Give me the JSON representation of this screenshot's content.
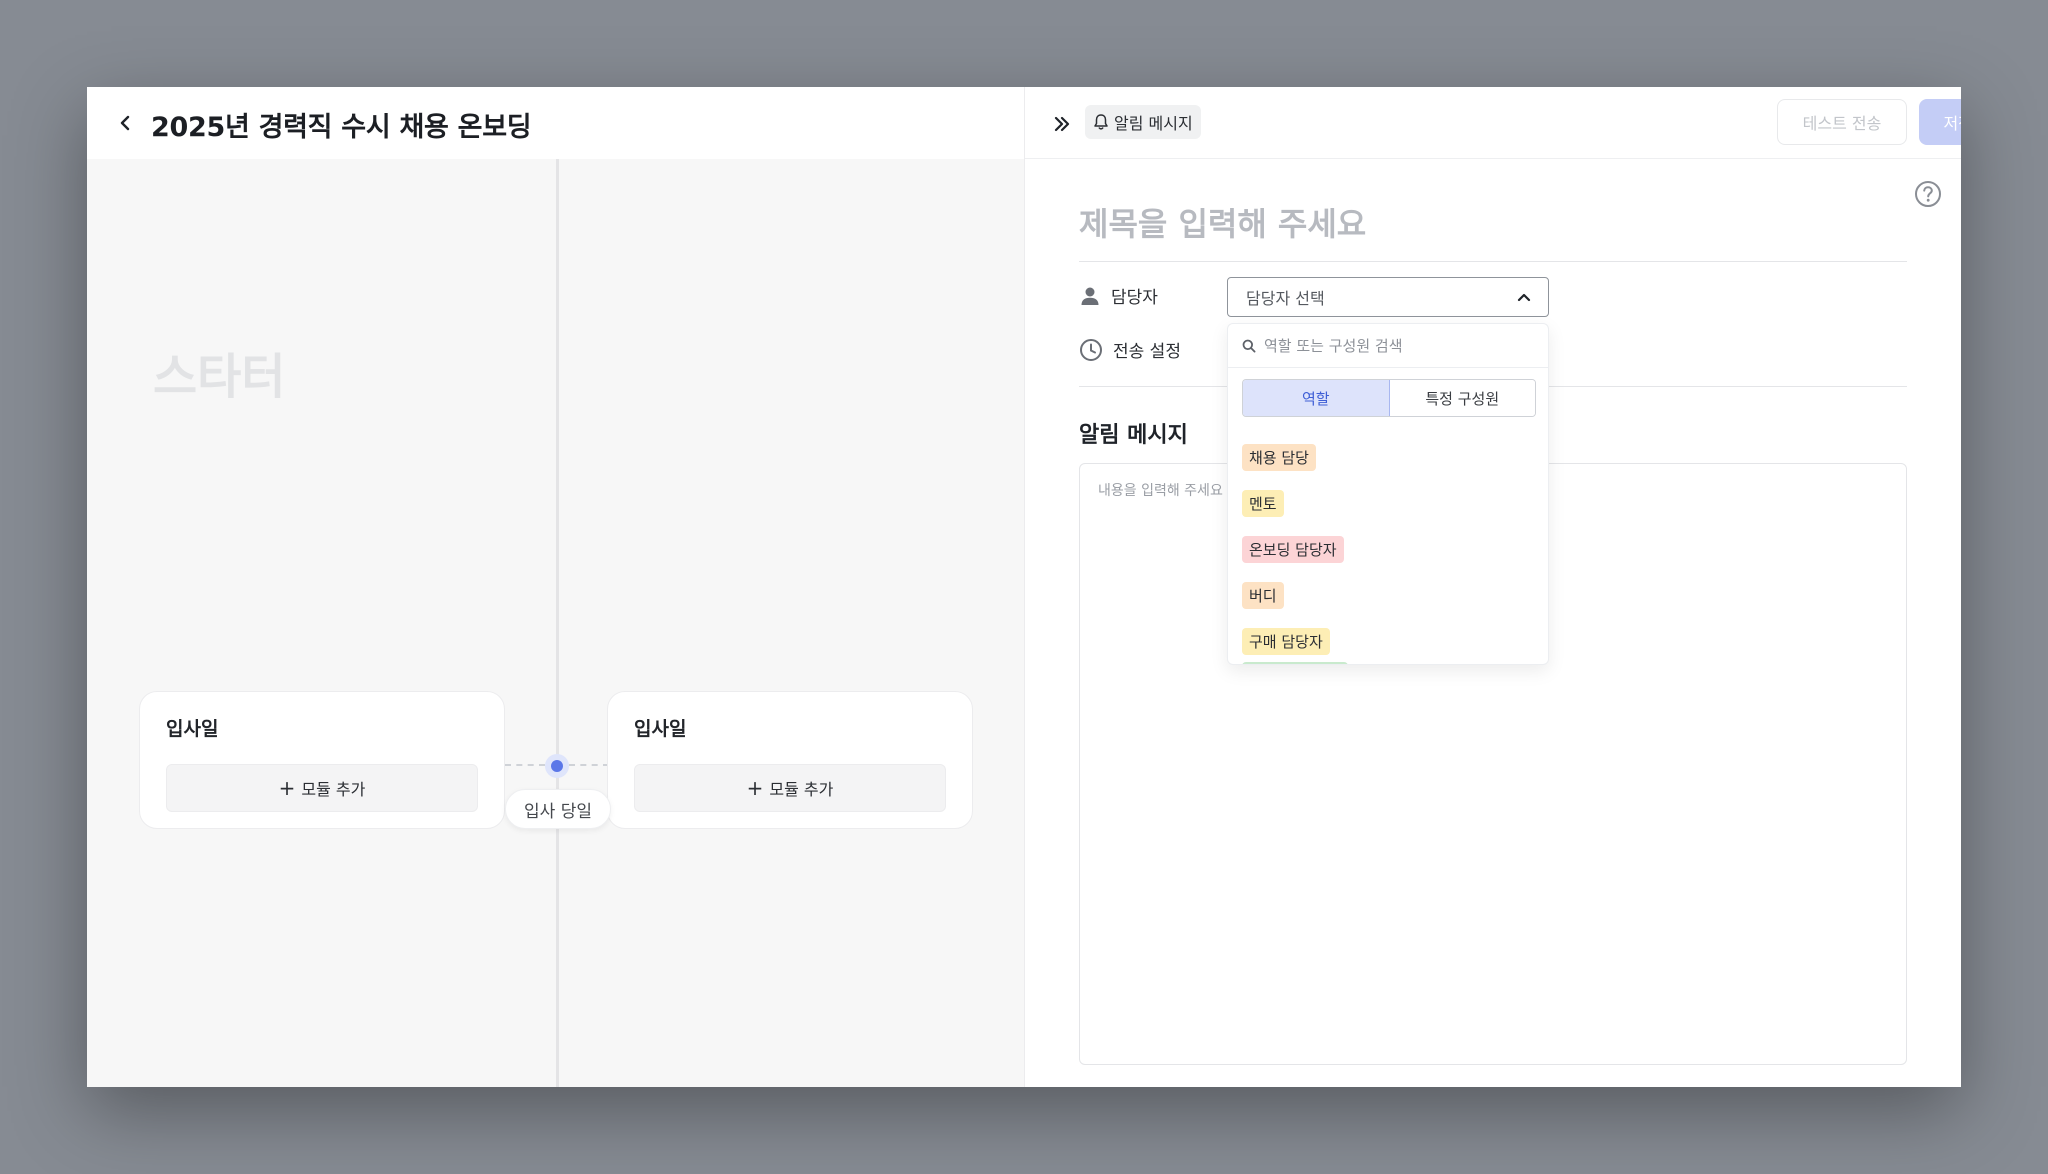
{
  "header": {
    "title": "2025년 경력직 수시 채용 온보딩"
  },
  "canvas": {
    "starter_label": "스타터",
    "cards": [
      {
        "title": "입사일",
        "add_label": "모듈 추가"
      },
      {
        "title": "입사일",
        "add_label": "모듈 추가"
      }
    ],
    "day_label": "입사 당일"
  },
  "panel": {
    "type_label": "알림 메시지",
    "test_send_label": "테스트 전송",
    "save_label": "저장하기",
    "title_placeholder": "제목을 입력해 주세요",
    "assignee_label": "담당자",
    "assignee_placeholder": "담당자 선택",
    "send_setting_label": "전송 설정",
    "message_section_title": "알림 메시지",
    "message_placeholder": "내용을 입력해 주세요"
  },
  "dropdown": {
    "search_placeholder": "역할 또는 구성원 검색",
    "tabs": [
      {
        "label": "역할",
        "active": true
      },
      {
        "label": "특정 구성원",
        "active": false
      }
    ],
    "items": [
      {
        "label": "채용 담당",
        "color": "#fde2c4"
      },
      {
        "label": "멘토",
        "color": "#fdeeb5"
      },
      {
        "label": "온보딩 담당자",
        "color": "#fcd4d6"
      },
      {
        "label": "버디",
        "color": "#fde2c4"
      },
      {
        "label": "구매 담당자",
        "color": "#fdeeb5"
      }
    ]
  },
  "colors": {
    "accent": "#5b77e8",
    "save_button_bg": "#c4cdf6",
    "active_tab_bg": "#dde3fb"
  }
}
